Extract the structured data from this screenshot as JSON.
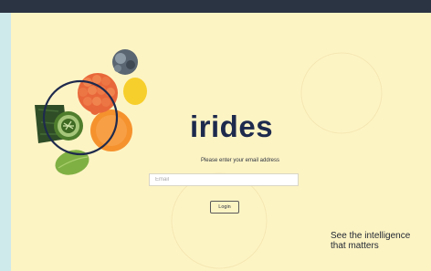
{
  "brand": {
    "name": "irides"
  },
  "login_form": {
    "prompt": "Please enter your email address",
    "email_placeholder": "Email",
    "login_label": "Login"
  },
  "tagline": {
    "line1": "See the intelligence",
    "line2": "that matters"
  },
  "colors": {
    "brand_navy": "#1e2a4d",
    "page_background": "#fdf4c4",
    "outer_background": "#cfeaeb",
    "top_bar": "#2b3442"
  }
}
